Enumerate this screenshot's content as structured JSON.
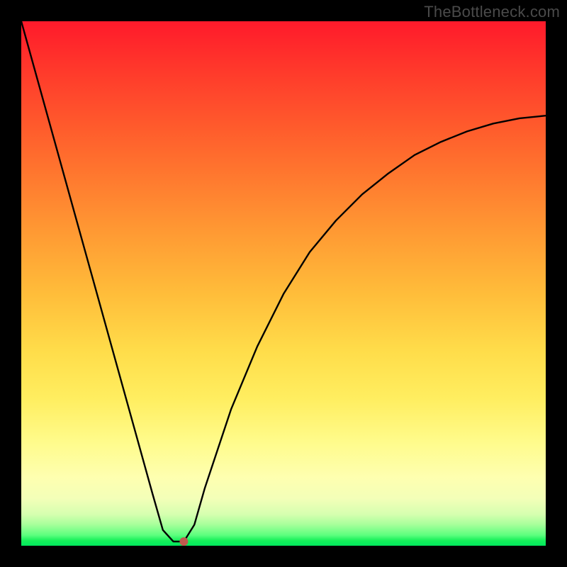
{
  "watermark": "TheBottleneck.com",
  "colors": {
    "background": "#000000",
    "gradient_top": "#ff1a2b",
    "gradient_bottom": "#00e85d",
    "curve": "#000000",
    "marker": "#c0594e"
  },
  "chart_data": {
    "type": "line",
    "title": "",
    "xlabel": "",
    "ylabel": "",
    "xlim": [
      0,
      100
    ],
    "ylim": [
      0,
      100
    ],
    "series": [
      {
        "name": "bottleneck-curve",
        "x": [
          0,
          5,
          10,
          15,
          20,
          25,
          27,
          29,
          30,
          31,
          33,
          35,
          40,
          45,
          50,
          55,
          60,
          65,
          70,
          75,
          80,
          85,
          90,
          95,
          100
        ],
        "values": [
          100,
          82,
          64,
          46,
          28,
          10,
          3,
          0.8,
          0.8,
          0.8,
          4,
          11,
          26,
          38,
          48,
          56,
          62,
          67,
          71,
          74.5,
          77,
          79,
          80.5,
          81.5,
          82
        ]
      }
    ],
    "annotations": [
      {
        "name": "sweet-spot-marker",
        "x": 31,
        "y": 0.8
      }
    ],
    "curve_notes": "Left branch descends roughly linearly from top-left; dips to a small flat minimum near x≈29–31 at the very bottom; right branch rises with decreasing slope, asymptoting around y≈82 at the right edge."
  }
}
